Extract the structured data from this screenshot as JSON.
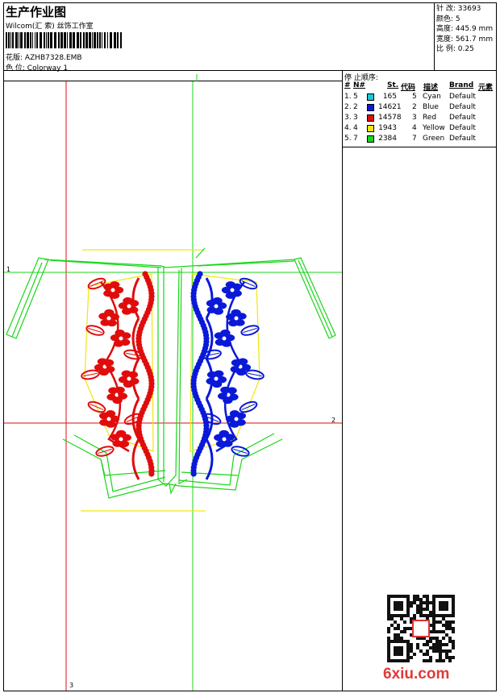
{
  "header": {
    "title": "生产作业图",
    "subtitle": "Wilcom(汇 索) 丝饰工作室",
    "design_label": "花版:",
    "design_value": "AZHB7328.EMB",
    "colorway_label": "色 位:",
    "colorway_value": "Colorway 1"
  },
  "stats": [
    {
      "label": "针 改:",
      "value": "33693"
    },
    {
      "label": "颜色:",
      "value": "5"
    },
    {
      "label": "高度:",
      "value": "445.9 mm"
    },
    {
      "label": "宽度:",
      "value": "561.7 mm"
    },
    {
      "label": "比 例:",
      "value": "0.25"
    }
  ],
  "stop_sequence": {
    "title": "停 止顺序:",
    "columns": [
      "#",
      "N#",
      "St.",
      "代码",
      "描述",
      "Brand",
      "元素"
    ],
    "rows": [
      {
        "idx": "1.",
        "n": "5",
        "color": "#19c9d6",
        "st": "165",
        "code": "5",
        "desc": "Cyan",
        "brand": "Default"
      },
      {
        "idx": "2.",
        "n": "2",
        "color": "#0a19d8",
        "st": "14621",
        "code": "2",
        "desc": "Blue",
        "brand": "Default"
      },
      {
        "idx": "3.",
        "n": "3",
        "color": "#e00c0c",
        "st": "14578",
        "code": "3",
        "desc": "Red",
        "brand": "Default"
      },
      {
        "idx": "4.",
        "n": "4",
        "color": "#f2e60a",
        "st": "1943",
        "code": "4",
        "desc": "Yellow",
        "brand": "Default"
      },
      {
        "idx": "5.",
        "n": "7",
        "color": "#19d619",
        "st": "2384",
        "code": "7",
        "desc": "Green",
        "brand": "Default"
      }
    ]
  },
  "axes": {
    "one": "1",
    "two": "2",
    "three": "3"
  },
  "brand_mark": "6xiu.com",
  "colors": {
    "red": "#e00c0c",
    "blue": "#0a19d8",
    "green": "#19d619",
    "yellow": "#f2e60a"
  }
}
